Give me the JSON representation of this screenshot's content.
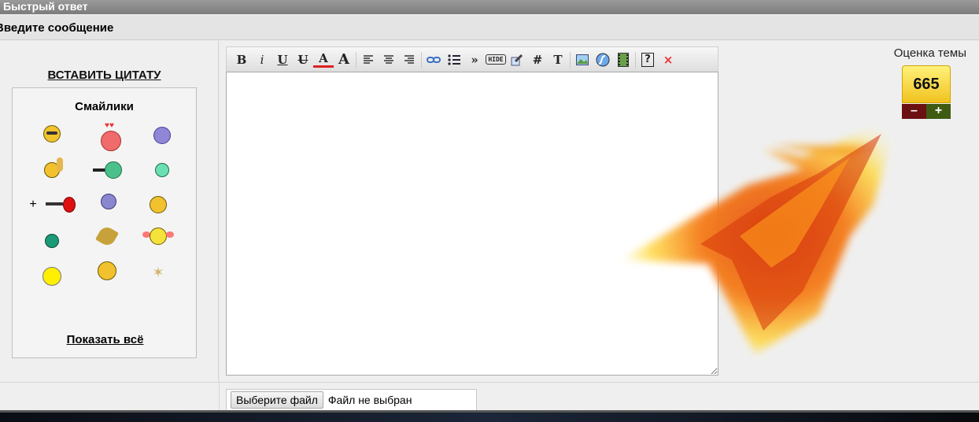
{
  "header": {
    "title": "Быстрый ответ",
    "message_label": "Введите сообщение"
  },
  "left": {
    "insert_quote": "ВСТАВИТЬ ЦИТАТУ",
    "smilies_title": "Смайлики",
    "show_all": "Показать всё",
    "plus_marker": "+"
  },
  "toolbar": {
    "bold": "B",
    "italic": "i",
    "underline": "U",
    "strike": "U",
    "color": "A",
    "size": "A",
    "quote": "»",
    "hide": "HIDE",
    "code": "#",
    "text": "T",
    "help": "?",
    "close": "×"
  },
  "rating": {
    "label": "Оценка темы",
    "value": "665",
    "minus": "–",
    "plus": "+"
  },
  "file": {
    "button": "Выберите файл",
    "status": "Файл не выбран"
  },
  "colors": {
    "accent_yellow": "#f1c21f",
    "minus_red": "#6b1111",
    "plus_green": "#3f5b12"
  }
}
